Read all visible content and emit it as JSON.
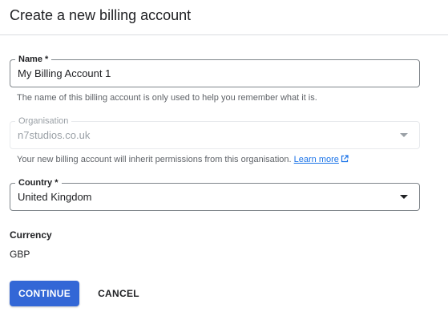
{
  "header": {
    "title": "Create a new billing account"
  },
  "name_field": {
    "label": "Name *",
    "value": "My Billing Account 1",
    "hint": "The name of this billing account is only used to help you remember what it is."
  },
  "organisation_field": {
    "label": "Organisation",
    "value": "n7studios.co.uk",
    "hint": "Your new billing account will inherit permissions from this organisation.",
    "link": "Learn more",
    "link_icon": "external-link-icon"
  },
  "country_field": {
    "label": "Country *",
    "value": "United Kingdom",
    "dropdown_icon": "dropdown-arrow-icon"
  },
  "currency": {
    "label": "Currency",
    "value": "GBP"
  },
  "actions": {
    "continue": "CONTINUE",
    "cancel": "CANCEL"
  },
  "colors": {
    "primary": "#3367d6",
    "link": "#1a73e8",
    "border": "#80868b",
    "disabled": "#9aa0a6",
    "hint_text": "#5f6368"
  }
}
